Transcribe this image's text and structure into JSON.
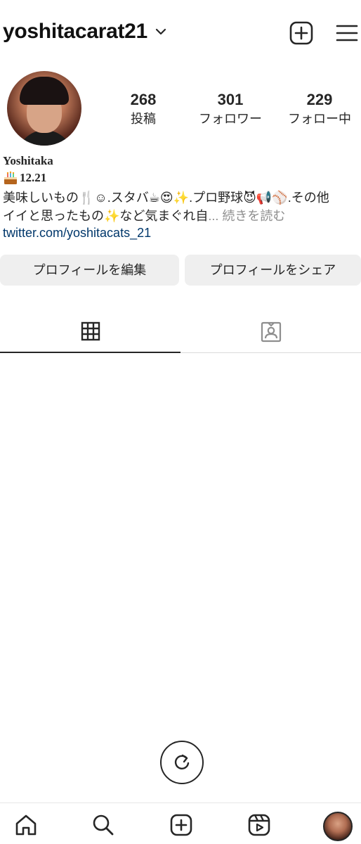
{
  "header": {
    "username": "yoshitacarat21",
    "icons": [
      "chevron-down-icon",
      "new-post-icon",
      "menu-icon"
    ]
  },
  "profile": {
    "display_name": "Yoshitaka",
    "birthday": "12.21",
    "bio_line1": "美味しいもの🍴☺.スタバ☕😍✨.プロ野球😈📢⚾.その他",
    "bio_line2": "イイと思ったもの✨など気まぐれ自",
    "bio_more": "... 続きを読む",
    "link": "twitter.com/yoshitacats_21"
  },
  "stats": [
    {
      "value": "268",
      "label": "投稿"
    },
    {
      "value": "301",
      "label": "フォロワー"
    },
    {
      "value": "229",
      "label": "フォロー中"
    }
  ],
  "buttons": {
    "edit_profile": "プロフィールを編集",
    "share_profile": "プロフィールをシェア"
  },
  "tabs": [
    {
      "name": "grid",
      "icon": "grid-icon",
      "active": true
    },
    {
      "name": "tagged",
      "icon": "tagged-user-icon",
      "active": false
    }
  ],
  "bottom_nav": [
    "home-icon",
    "search-icon",
    "create-icon",
    "reels-icon",
    "profile-avatar"
  ],
  "colors": {
    "text": "#262626",
    "link": "#00376b",
    "muted": "#8e8e8e",
    "button_bg": "#efefef"
  }
}
